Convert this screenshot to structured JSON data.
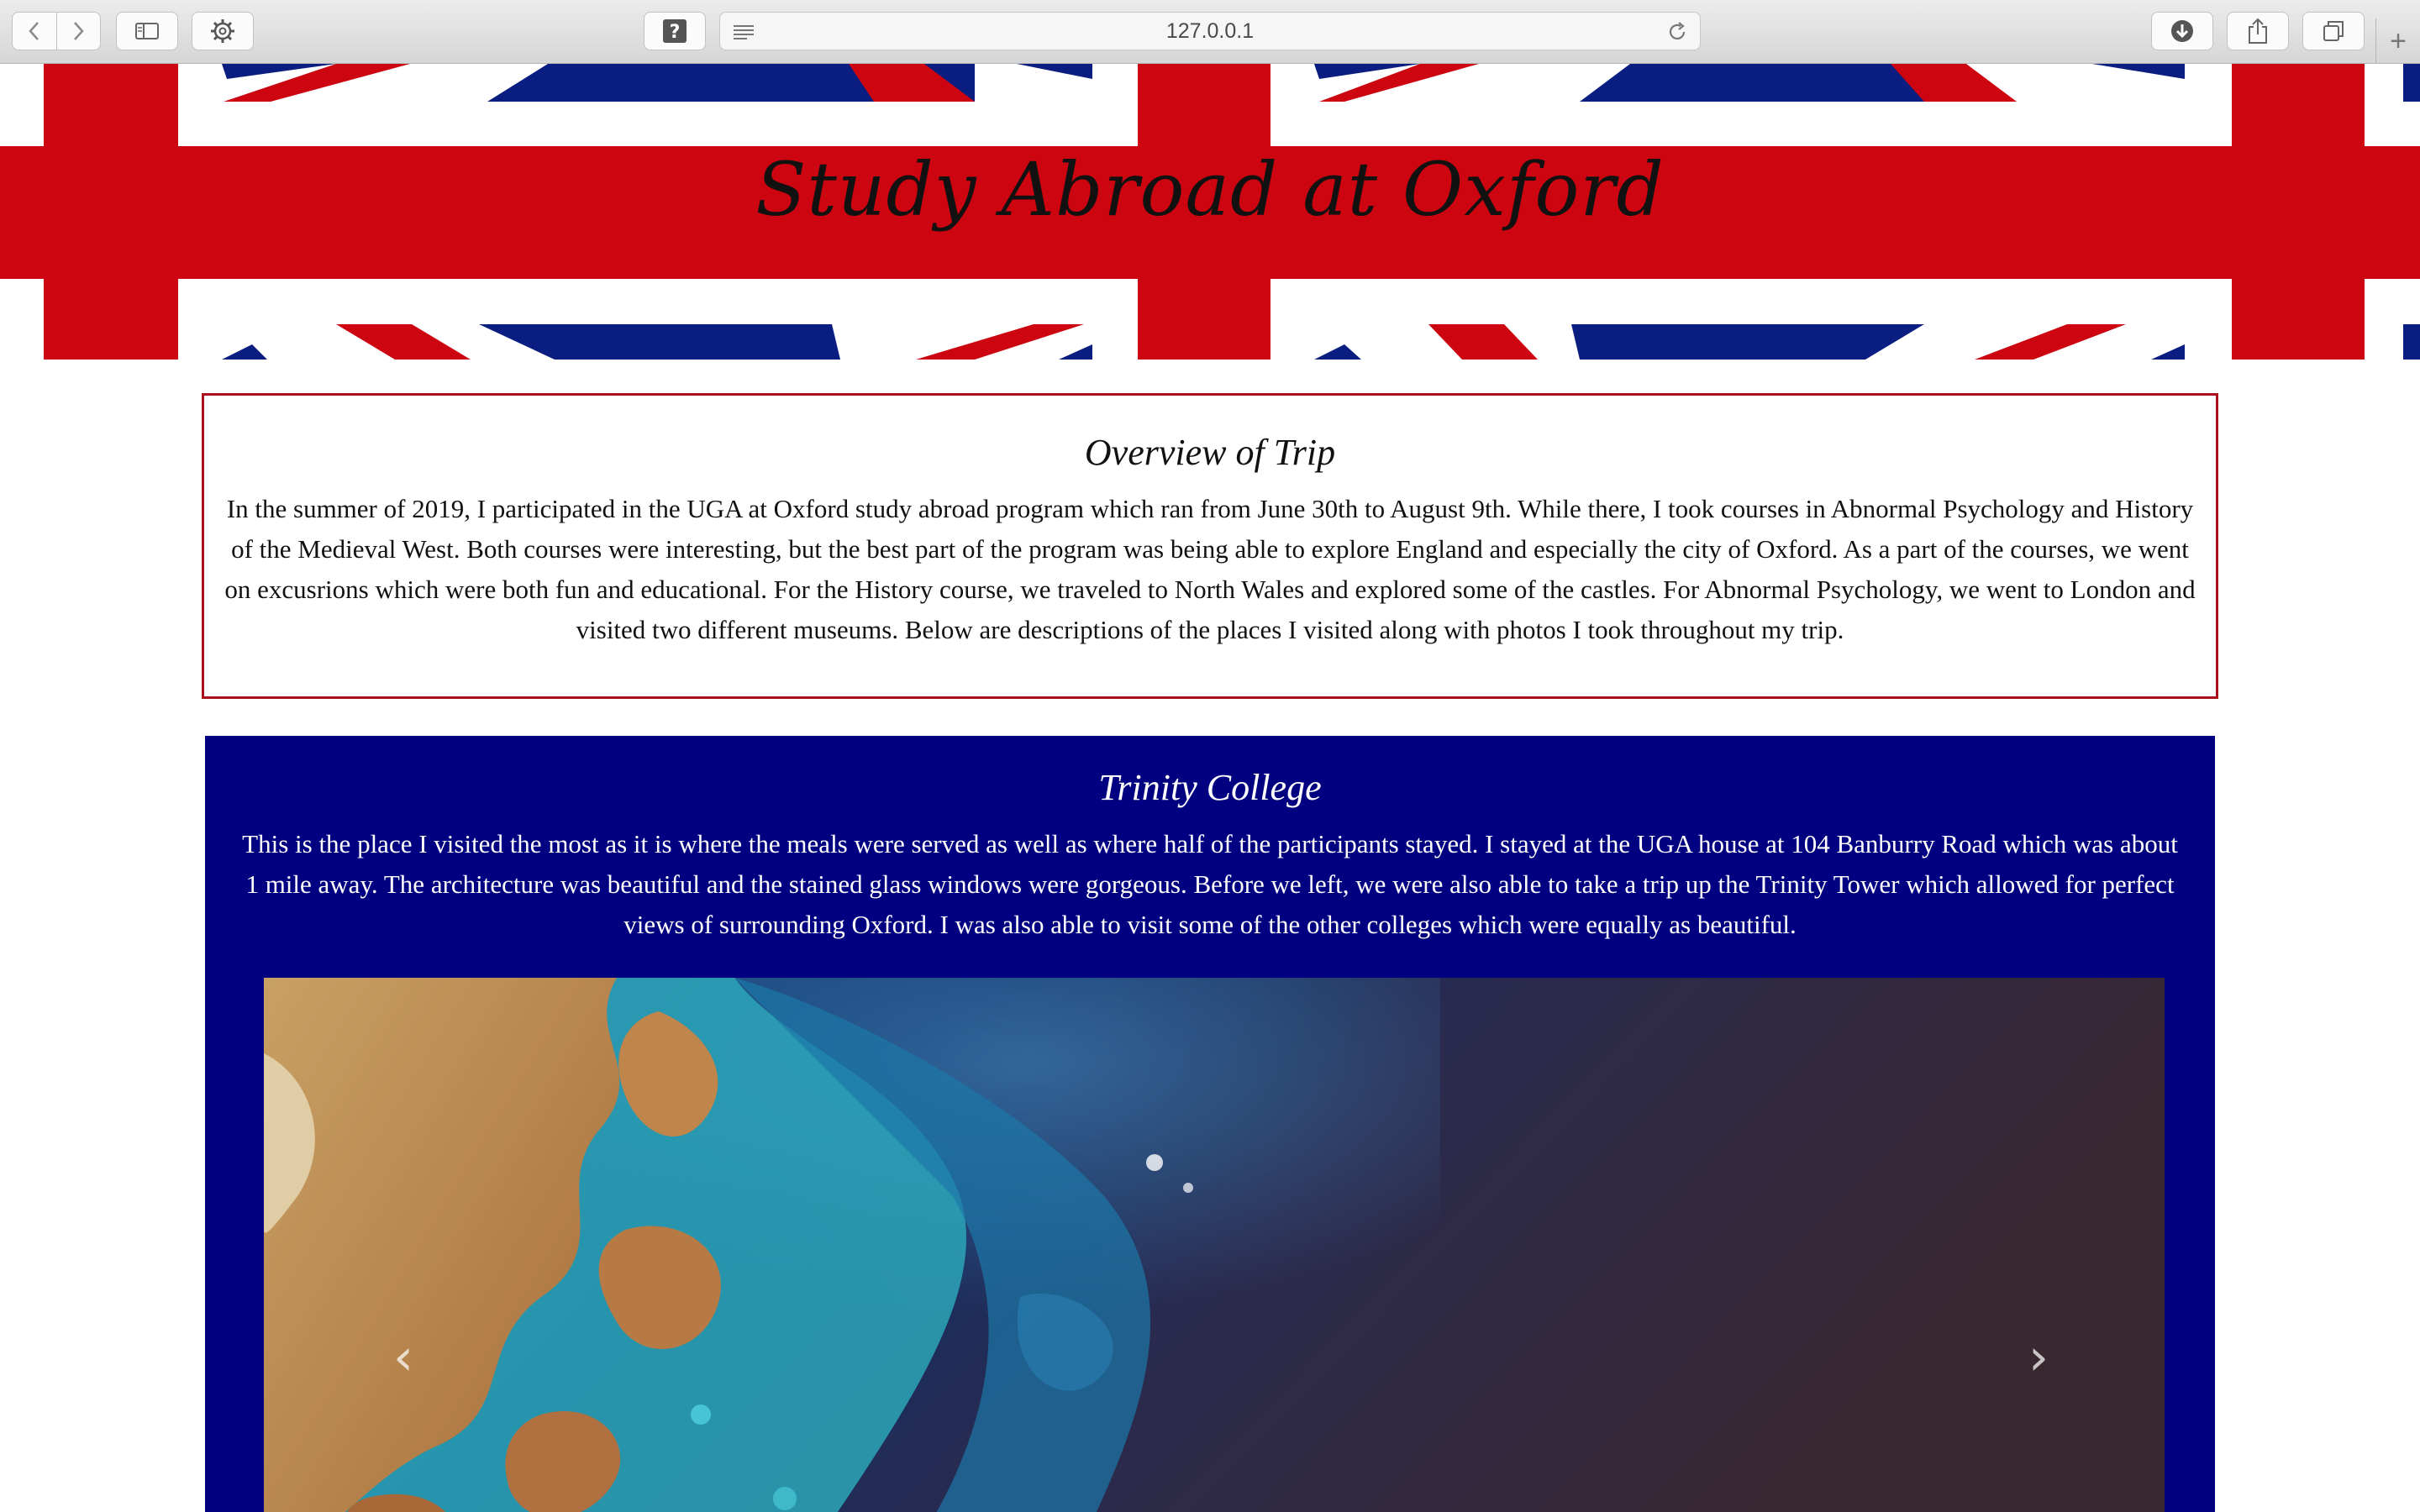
{
  "browser": {
    "url": "127.0.0.1",
    "icons": {
      "back": "chevron-left-icon",
      "forward": "chevron-right-icon",
      "sidebar": "sidebar-icon",
      "settings": "gear-icon",
      "help": "question-icon",
      "reader": "reader-icon",
      "reload": "reload-icon",
      "download": "download-icon",
      "share": "share-icon",
      "tabs": "tabs-icon"
    },
    "new_tab_label": "+"
  },
  "banner": {
    "title": "Study Abroad at Oxford",
    "colors": {
      "red": "#cc0510",
      "blue": "#0a1e82",
      "white": "#ffffff"
    }
  },
  "overview": {
    "heading": "Overview of Trip",
    "body": "In the summer of 2019, I participated in the UGA at Oxford study abroad program which ran from June 30th to August 9th. While there, I took courses in Abnormal Psychology and History of the Medieval West. Both courses were interesting, but the best part of the program was being able to explore England and especially the city of Oxford. As a part of the courses, we went on excusrions which were both fun and educational. For the History course, we traveled to North Wales and explored some of the castles. For Abnormal Psychology, we went to London and visited two different museums. Below are descriptions of the places I visited along with photos I took throughout my trip.",
    "border_color": "#a80f1f"
  },
  "trinity": {
    "heading": "Trinity College",
    "body": "This is the place I visited the most as it is where the meals were served as well as where half of the participants stayed. I stayed at the UGA house at 104 Banburry Road which was about 1 mile away. The architecture was beautiful and the stained glass windows were gorgeous. Before we left, we were also able to take a trip up the Trinity Tower which allowed for perfect views of surrounding Oxford. I was also able to visit some of the other colleges which were equally as beautiful.",
    "background": "#000080",
    "carousel": {
      "prev_icon": "chevron-left-icon",
      "next_icon": "chevron-right-icon",
      "prev_glyph": "‹",
      "next_glyph": "›"
    }
  }
}
